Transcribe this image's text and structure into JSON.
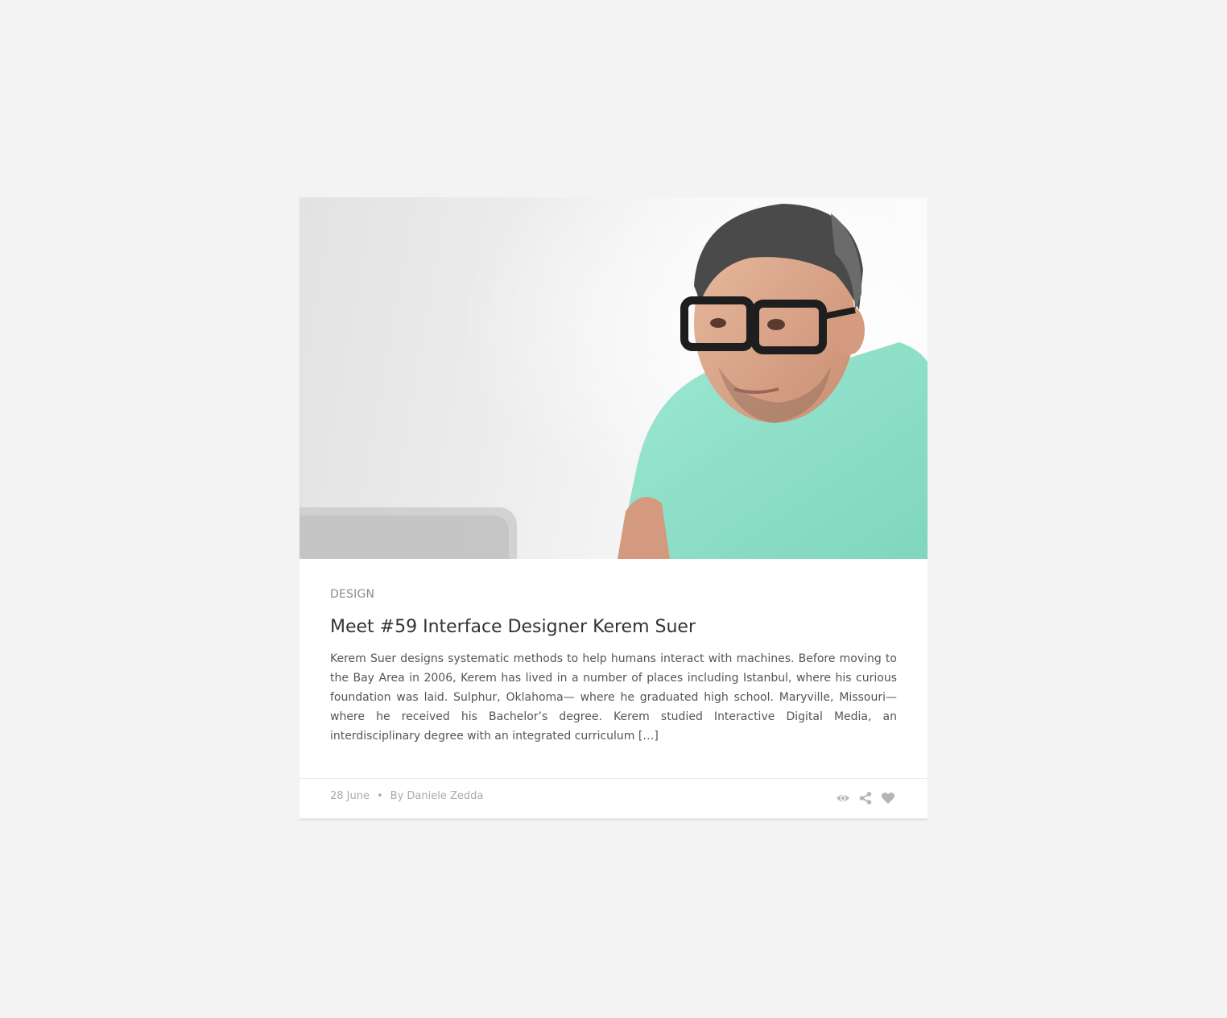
{
  "post": {
    "image_alt": "Portrait of a man with glasses in a mint t-shirt",
    "category": "DESIGN",
    "title": "Meet #59 Interface Designer Kerem Suer",
    "excerpt": "Kerem Suer designs systematic methods to help humans interact with machines. Before moving to the Bay Area in 2006, Kerem has lived in a number of places including Istanbul, where his curious foundation was laid. Sulphur, Oklahoma— where he graduated high school. Maryville, Missouri— where he received his Bachelor’s degree. Kerem studied Interactive Digital Media, an interdisciplinary degree with an integrated curriculum […]",
    "date": "28 June",
    "separator": "•",
    "author": "By Daniele Zedda",
    "actions": [
      "eye-icon",
      "share-icon",
      "heart-icon"
    ]
  },
  "colors": {
    "page_background": "#f3f3f3",
    "card_background": "#ffffff",
    "shirt": "#8fe0c8",
    "text_dark": "#333333",
    "text_muted": "#aaaaaa"
  }
}
